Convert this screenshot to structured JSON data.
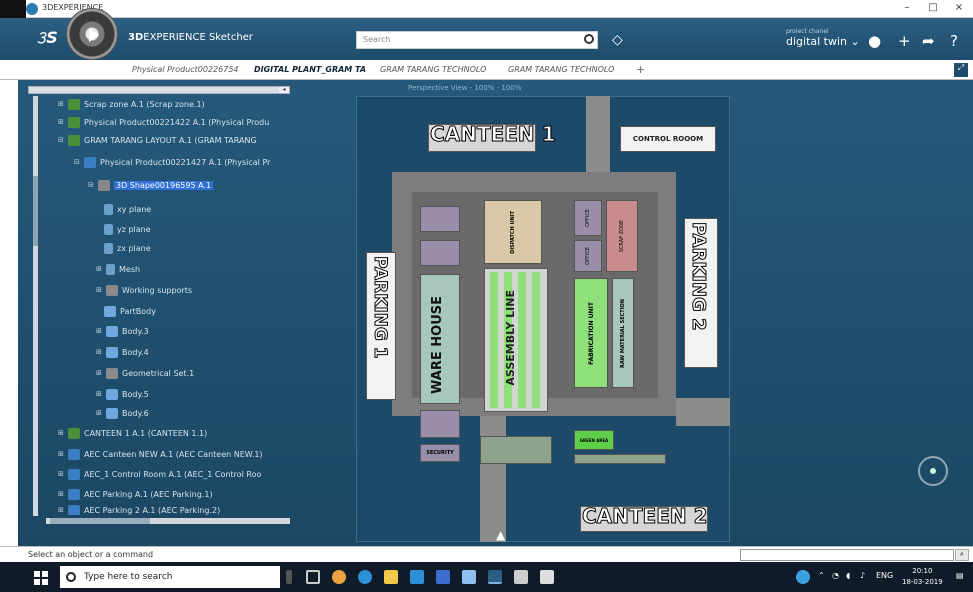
{
  "window": {
    "title": "3DEXPERIENCE",
    "minimize": "–",
    "maximize": "□",
    "close": "×"
  },
  "header": {
    "brand_bold": "3D",
    "brand_rest": "EXPERIENCE Sketcher",
    "search_placeholder": "Search",
    "user_label": "proiect chanel",
    "user_name": "digital twin ⌄"
  },
  "tabs": [
    {
      "label": "Physical Product00226754"
    },
    {
      "label": "DIGITAL PLANT_GRAM TA"
    },
    {
      "label": "GRAM TARANG TECHNOLO"
    },
    {
      "label": "GRAM TARANG TECHNOLO"
    }
  ],
  "tree": {
    "items": [
      {
        "label": "Scrap zone A.1 (Scrap zone.1)"
      },
      {
        "label": "Physical Product00221422 A.1 (Physical Produ"
      },
      {
        "label": "GRAM TARANG LAYOUT A.1 (GRAM TARANG"
      },
      {
        "label": "Physical Product00221427 A.1 (Physical Pr"
      },
      {
        "label": "3D Shape00196595 A.1"
      },
      {
        "label": "xy plane"
      },
      {
        "label": "yz plane"
      },
      {
        "label": "zx plane"
      },
      {
        "label": "Mesh"
      },
      {
        "label": "Working supports"
      },
      {
        "label": "PartBody"
      },
      {
        "label": "Body.3"
      },
      {
        "label": "Body.4"
      },
      {
        "label": "Geometrical Set.1"
      },
      {
        "label": "Body.5"
      },
      {
        "label": "Body.6"
      },
      {
        "label": "CANTEEN 1 A.1 (CANTEEN 1.1)"
      },
      {
        "label": "AEC Canteen NEW A.1 (AEC Canteen NEW.1)"
      },
      {
        "label": "AEC_1 Control Room A.1 (AEC_1 Control Roo"
      },
      {
        "label": "AEC Parking A.1 (AEC Parking.1)"
      },
      {
        "label": "AEC Parking 2 A.1 (AEC Parking.2)"
      }
    ]
  },
  "viewport": {
    "view_label": "Perspective View - 100% - 100%",
    "labels": {
      "canteen1": "CANTEEN 1",
      "canteen2": "CANTEEN 2",
      "control_room": "CONTROL ROOOM",
      "parking1": "PARKING 1",
      "parking2": "PARKING 2",
      "warehouse": "WARE HOUSE",
      "assembly": "ASSEMBLY LINE",
      "dispatch": "DISPATCH UNIT",
      "fabrication": "FABRICATION UNIT",
      "raw": "RAW MATERIAL SECTION",
      "scrap": "SCRAP ZONE",
      "office1": "OFFICE",
      "office2": "OFFICE",
      "security": "SECURITY",
      "green_area": "GREEN AREA"
    }
  },
  "status": {
    "message": "Select an object or a command"
  },
  "taskbar": {
    "search_text": "Type here to search",
    "tray_lang": "ENG",
    "time": "20:10",
    "date": "18-03-2019"
  }
}
